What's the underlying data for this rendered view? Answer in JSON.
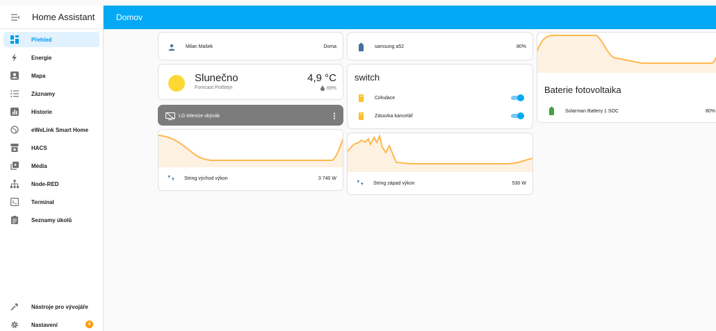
{
  "app": {
    "title": "Home Assistant"
  },
  "sidebar": {
    "items": [
      {
        "label": "Přehled",
        "icon": "view-dashboard-icon"
      },
      {
        "label": "Energie",
        "icon": "lightning-bolt-icon"
      },
      {
        "label": "Mapa",
        "icon": "account-box-icon"
      },
      {
        "label": "Záznamy",
        "icon": "format-list-bulleted-icon"
      },
      {
        "label": "Historie",
        "icon": "chart-box-icon"
      },
      {
        "label": "eWeLink Smart Home",
        "icon": "web-icon"
      },
      {
        "label": "HACS",
        "icon": "hacs-icon"
      },
      {
        "label": "Média",
        "icon": "play-box-multiple-icon"
      },
      {
        "label": "Node-RED",
        "icon": "sitemap-icon"
      },
      {
        "label": "Terminal",
        "icon": "console-icon"
      },
      {
        "label": "Seznamy úkolů",
        "icon": "clipboard-list-icon"
      }
    ],
    "bottom": [
      {
        "label": "Nástroje pro vývojáře",
        "icon": "hammer-icon"
      },
      {
        "label": "Nastavení",
        "icon": "cog-icon",
        "badge": "4"
      }
    ]
  },
  "header": {
    "title": "Domov"
  },
  "cards": {
    "person": {
      "name": "Milan Mašek",
      "state": "Doma"
    },
    "weather": {
      "condition": "Slunečno",
      "location": "Forecast Potštejn",
      "temperature": "4,9 °C",
      "humidity": "69%"
    },
    "media": {
      "name": "LG televize obývák",
      "state": "off"
    },
    "string_east": {
      "name": "String východ výkon",
      "value": "3 740 W"
    },
    "phone": {
      "name": "samsung a52",
      "value": "80%"
    },
    "switch": {
      "title": "switch",
      "items": [
        {
          "name": "Cirkulace",
          "on": true
        },
        {
          "name": "Zásuvka kancelář",
          "on": true
        }
      ]
    },
    "string_west": {
      "name": "String západ výkon",
      "value": "530 W"
    },
    "battery": {
      "title": "Baterie fotovoltaika",
      "name": "Solarman Battery 1 SOC",
      "value": "80%"
    }
  },
  "colors": {
    "accent": "#03a9f4",
    "graph_line": "#ffb74d",
    "graph_fill": "#fdf1e2",
    "sun": "#fdd835",
    "battery_green": "#43a047",
    "switch_icon": "#fbc02d",
    "media_card": "#7c7c7c"
  }
}
